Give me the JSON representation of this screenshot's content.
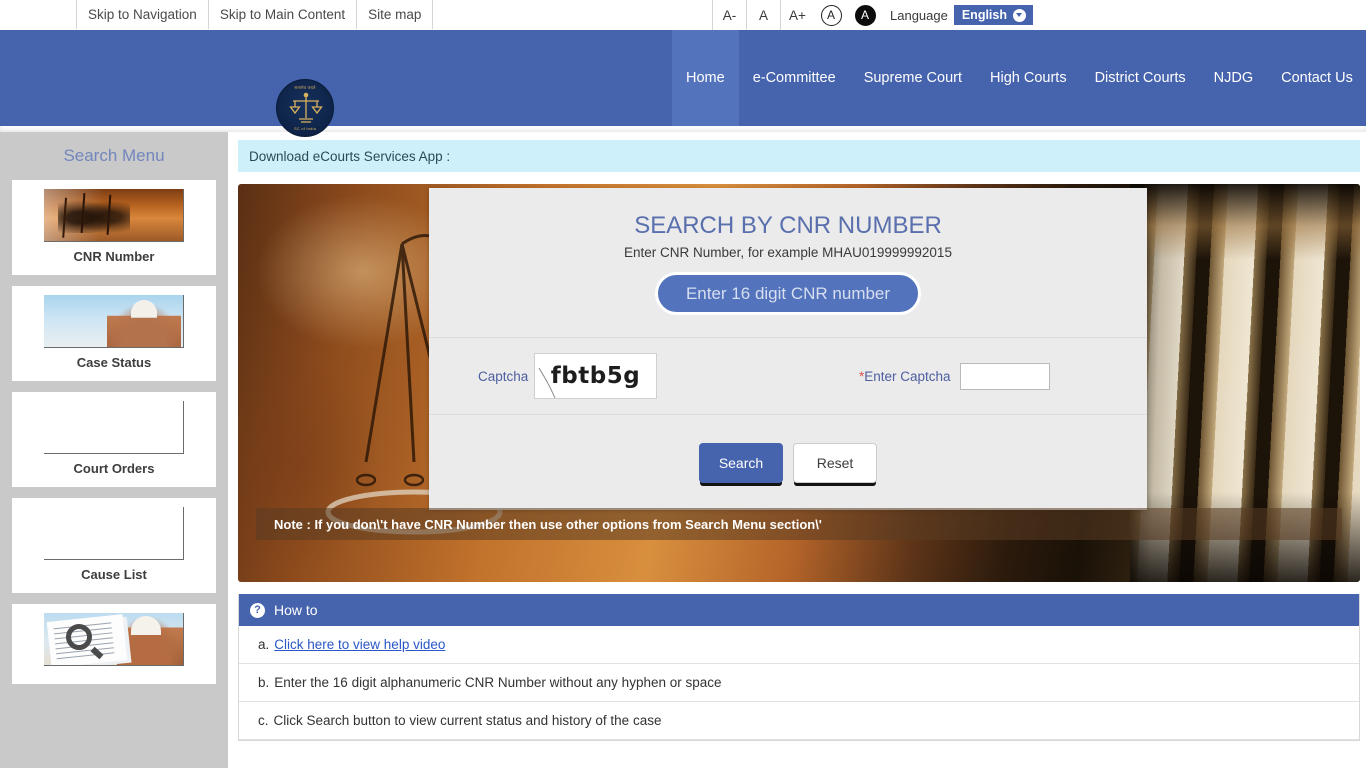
{
  "topbar": {
    "skip_links": [
      {
        "label": "Skip to Navigation",
        "name": "skip-to-navigation"
      },
      {
        "label": "Skip to Main Content",
        "name": "skip-to-main-content"
      },
      {
        "label": "Site map",
        "name": "site-map"
      }
    ],
    "font_decrease": "A-",
    "font_normal": "A",
    "font_increase": "A+",
    "contrast_normal": "A",
    "contrast_high": "A",
    "language_label": "Language",
    "language_value": "English"
  },
  "header": {
    "logo_top_text": "सत्यमेव जयते",
    "logo_bottom_text": "SC of India",
    "nav": [
      {
        "label": "Home",
        "active": true
      },
      {
        "label": "e-Committee",
        "active": false
      },
      {
        "label": "Supreme Court",
        "active": false
      },
      {
        "label": "High Courts",
        "active": false
      },
      {
        "label": "District Courts",
        "active": false
      },
      {
        "label": "NJDG",
        "active": false
      },
      {
        "label": "Contact Us",
        "active": false
      }
    ]
  },
  "sidebar": {
    "title": "Search Menu",
    "items": [
      {
        "label": "CNR Number",
        "thumb": "scales-of-justice-image",
        "has_image": true
      },
      {
        "label": "Case Status",
        "thumb": "supreme-court-building-image",
        "has_image": true
      },
      {
        "label": "Court Orders",
        "thumb": "broken-image-placeholder",
        "has_image": false
      },
      {
        "label": "Cause List",
        "thumb": "broken-image-placeholder",
        "has_image": false
      },
      {
        "label": "",
        "thumb": "case-search-magnifier-image",
        "has_image": true
      }
    ]
  },
  "main": {
    "app_banner": "Download eCourts Services App :",
    "search_panel": {
      "title": "SEARCH BY CNR NUMBER",
      "subtitle": "Enter CNR Number, for example MHAU019999992015",
      "cnr_placeholder": "Enter 16 digit CNR number",
      "cnr_value": "",
      "captcha_label": "Captcha",
      "captcha_text": "fbtb5g",
      "enter_captcha_star": "*",
      "enter_captcha_label": "Enter Captcha",
      "enter_captcha_value": "",
      "search_button": "Search",
      "reset_button": "Reset"
    },
    "hero_note": "Note : If you don\\'t have CNR Number then use other options from Search Menu section\\'",
    "howto": {
      "heading": "How to",
      "items": [
        {
          "marker": "a.",
          "text": "Click here to view help video",
          "is_link": true
        },
        {
          "marker": "b.",
          "text": "Enter the 16 digit alphanumeric CNR Number without any hyphen or space",
          "is_link": false
        },
        {
          "marker": "c.",
          "text": "Click Search button to view current status and history of the case",
          "is_link": false
        }
      ]
    }
  },
  "colors": {
    "brand_blue": "#4663ad",
    "nav_active_blue": "#5473bd",
    "panel_bg": "#ebebeb",
    "title_blue": "#5a6fad",
    "banner_cyan": "#cdf0fa",
    "sidebar_gray": "#c9c9c9",
    "link_blue": "#2a56c6",
    "required_red": "#d9534f"
  }
}
